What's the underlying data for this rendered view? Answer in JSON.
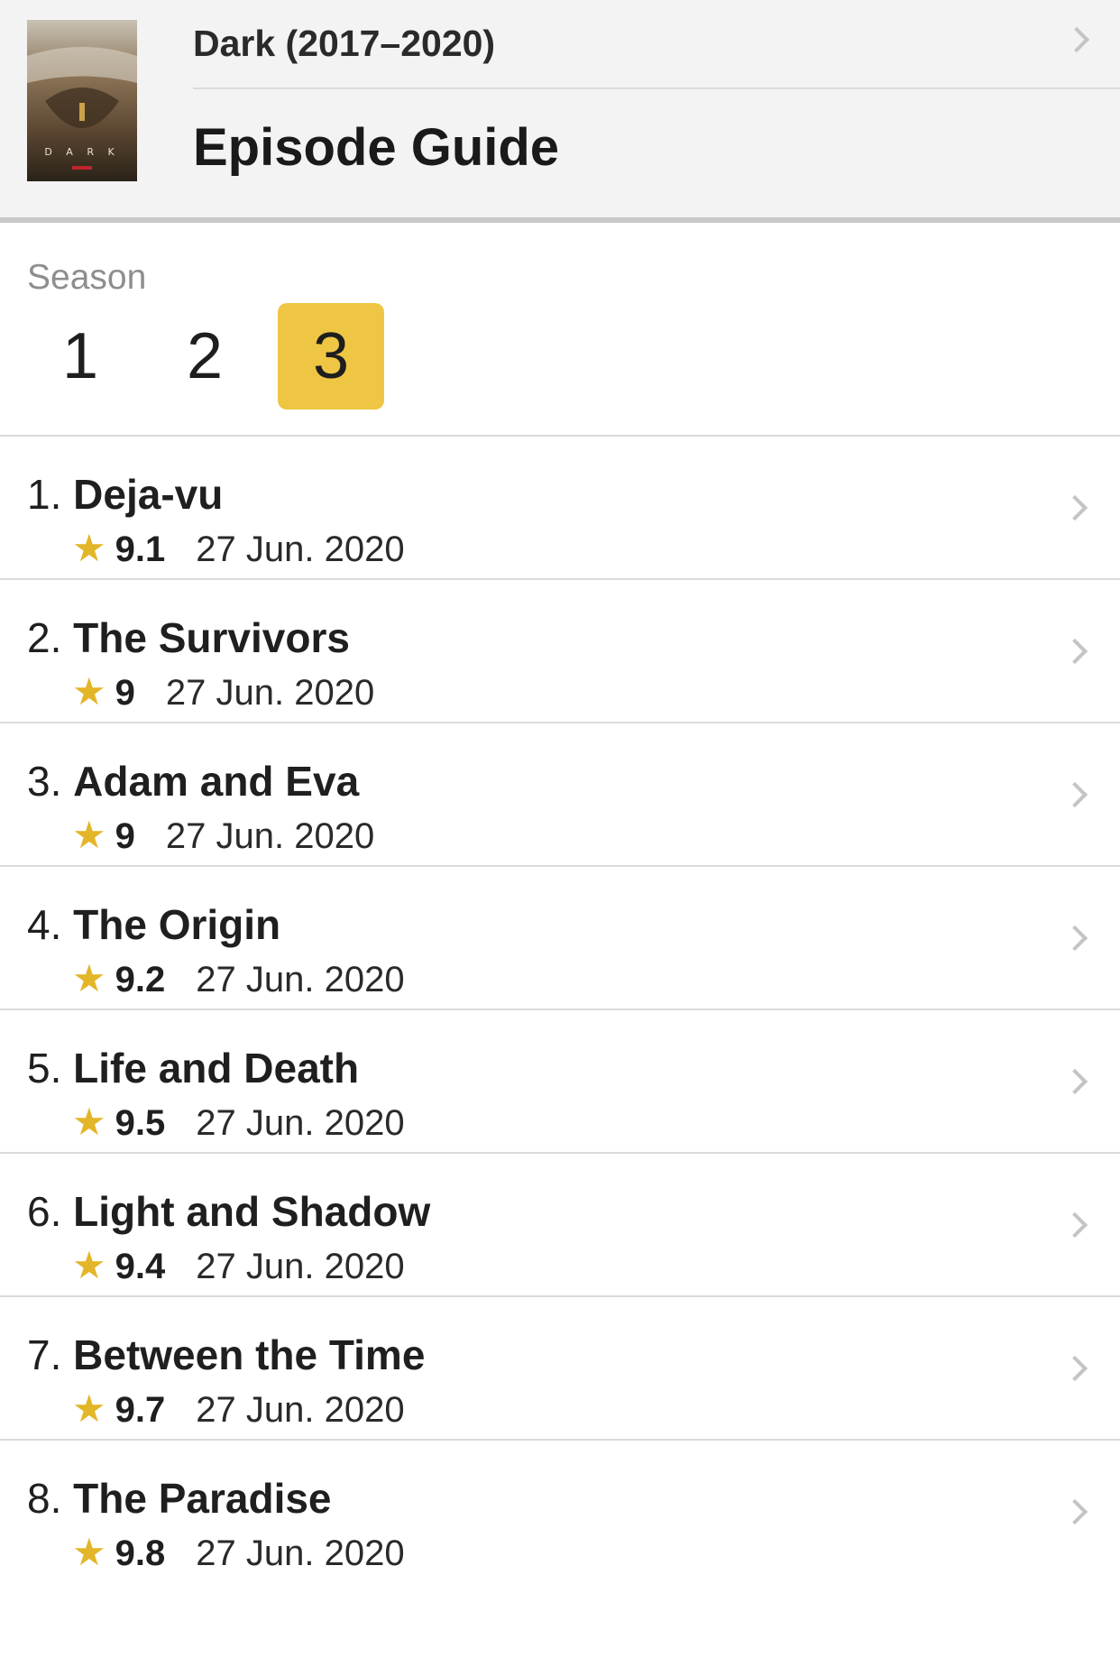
{
  "header": {
    "series_title": "Dark (2017–2020)",
    "page_title": "Episode Guide",
    "poster_text": "DARK"
  },
  "season": {
    "label": "Season",
    "tabs": [
      "1",
      "2",
      "3"
    ],
    "selected": "3"
  },
  "colors": {
    "accent": "#eec643",
    "star": "#e3b528"
  },
  "episodes": [
    {
      "number": "1.",
      "title": "Deja-vu",
      "rating": "9.1",
      "date": "27 Jun. 2020"
    },
    {
      "number": "2.",
      "title": "The Survivors",
      "rating": "9",
      "date": "27 Jun. 2020"
    },
    {
      "number": "3.",
      "title": "Adam and Eva",
      "rating": "9",
      "date": "27 Jun. 2020"
    },
    {
      "number": "4.",
      "title": "The Origin",
      "rating": "9.2",
      "date": "27 Jun. 2020"
    },
    {
      "number": "5.",
      "title": "Life and Death",
      "rating": "9.5",
      "date": "27 Jun. 2020"
    },
    {
      "number": "6.",
      "title": "Light and Shadow",
      "rating": "9.4",
      "date": "27 Jun. 2020"
    },
    {
      "number": "7.",
      "title": "Between the Time",
      "rating": "9.7",
      "date": "27 Jun. 2020"
    },
    {
      "number": "8.",
      "title": "The Paradise",
      "rating": "9.8",
      "date": "27 Jun. 2020"
    }
  ]
}
